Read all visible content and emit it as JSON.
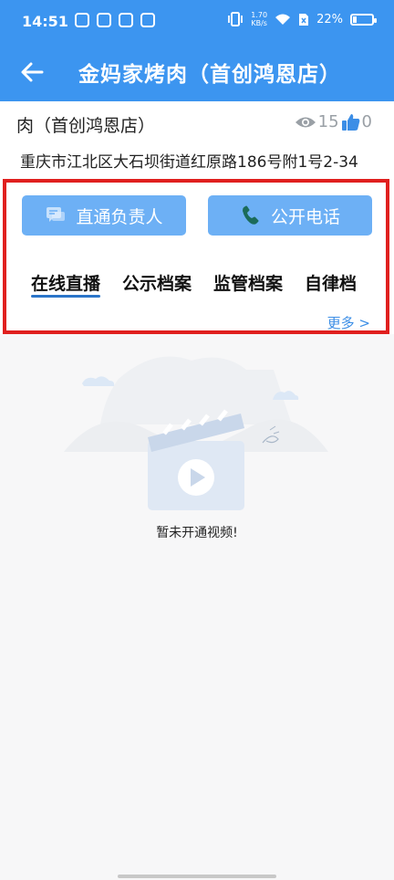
{
  "status_bar": {
    "time": "14:51",
    "net_speed_value": "1.70",
    "net_speed_unit": "KB/s",
    "battery_text": "22%",
    "battery_level": 0.22
  },
  "header": {
    "title": "金妈家烤肉（首创鸿恩店）",
    "back_icon": "arrow-left-icon",
    "background": "#3c95f0"
  },
  "store": {
    "name_line": "肉（首创鸿恩店）",
    "views": "15",
    "likes": "0",
    "address": "重庆市江北区大石坝街道红原路186号附1号2-34"
  },
  "actions": {
    "direct_label": "直通负责人",
    "phone_label": "公开电话",
    "button_color": "#6db0f5"
  },
  "tabs": [
    {
      "label": "在线直播",
      "active": true
    },
    {
      "label": "公示档案",
      "active": false
    },
    {
      "label": "监管档案",
      "active": false
    },
    {
      "label": "自律档",
      "active": false
    }
  ],
  "more_label": "更多 >",
  "empty_state": {
    "text": "暂未开通视频!"
  },
  "highlight_color": "#e0201f"
}
